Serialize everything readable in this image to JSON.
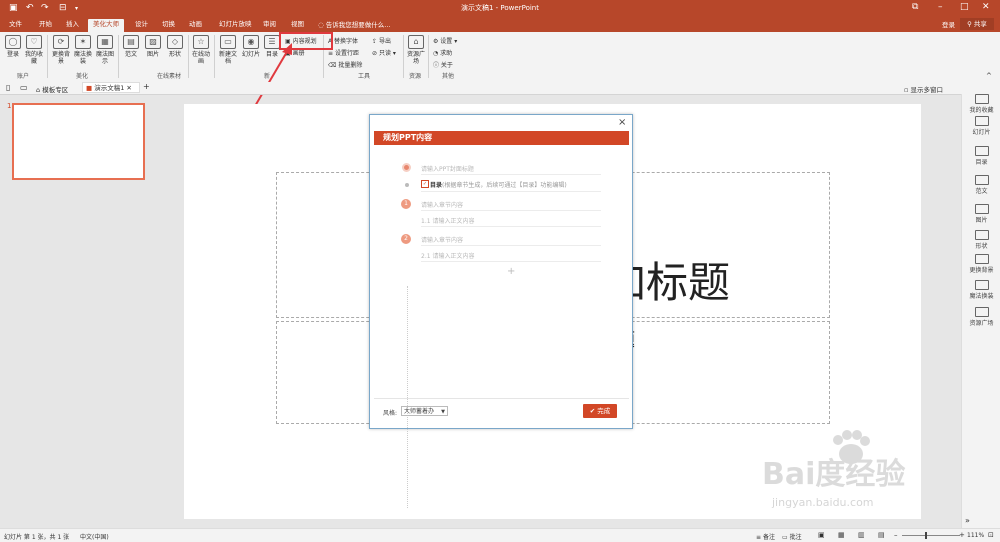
{
  "app": {
    "window_title": "演示文稿1 - PowerPoint",
    "quick_access": [
      "save-icon",
      "undo-icon",
      "redo-icon",
      "present-icon"
    ],
    "login": "登录",
    "share": "共享"
  },
  "tabs": [
    "文件",
    "开始",
    "插入",
    "美化大师",
    "设计",
    "切换",
    "动画",
    "幻灯片放映",
    "审阅",
    "视图"
  ],
  "active_tab": "美化大师",
  "tell_me": "告诉我您想要做什么...",
  "ribbon": {
    "groups": {
      "account": "账户",
      "beautify": "美化",
      "online": "在线素材",
      "new": "新",
      "tools": "工具",
      "resources": "资源",
      "other": "其他"
    },
    "buttons": {
      "login": "登录",
      "favorites": "我的收藏",
      "change_bg": "更换背景",
      "magic_swap": "魔法换装",
      "magic_chart": "魔法图示",
      "template": "范文",
      "picture": "图片",
      "shape": "形状",
      "online_anim": "在线动画",
      "new_doc": "新建文档",
      "slide": "幻灯片",
      "toc": "目录",
      "content_plan": "内容规划",
      "album": "画册",
      "replace_font": "替换字体",
      "line_spacing": "设置行距",
      "batch_delete": "批量删除",
      "export": "导出",
      "read_only": "只读",
      "resource_plaza": "资源广场",
      "settings": "设置",
      "help": "求助",
      "about": "关于"
    }
  },
  "doc_tabs": {
    "template_zone": "模板专区",
    "current_doc": "演示文稿1",
    "show_multi": "显示多窗口"
  },
  "thumb": {
    "number": "1"
  },
  "slide": {
    "title_fragment": "加标题",
    "subtitle_fragment": "题"
  },
  "right_panel": [
    "我的收藏",
    "幻灯片",
    "目录",
    "范文",
    "图片",
    "形状",
    "更换背景",
    "魔法换装",
    "资源广场"
  ],
  "dialog": {
    "title": "规划PPT内容",
    "close": "×",
    "cover_placeholder": "请输入PPT封面标题",
    "toc_label": "目录",
    "toc_hint": "(根据章节生成，后续可通过【目录】功能编辑)",
    "chapters": [
      {
        "number": "1",
        "title": "请输入章节内容",
        "body": "1.1  请输入正文内容"
      },
      {
        "number": "2",
        "title": "请输入章节内容",
        "body": "2.1  请输入正文内容"
      }
    ],
    "add": "+",
    "style_label": "风格:",
    "style_value": "大师蓄着办",
    "finish": "完成"
  },
  "status": {
    "slide_info": "幻灯片 第 1 张，共 1 张",
    "language": "中文(中国)",
    "notes": "备注",
    "comments": "批注",
    "zoom": "111%"
  },
  "watermark": {
    "text": "Bai度经验",
    "url": "jingyan.baidu.com"
  },
  "colors": {
    "accent": "#b7472a",
    "dialog_header": "#d24726",
    "highlight": "#e0393e"
  }
}
